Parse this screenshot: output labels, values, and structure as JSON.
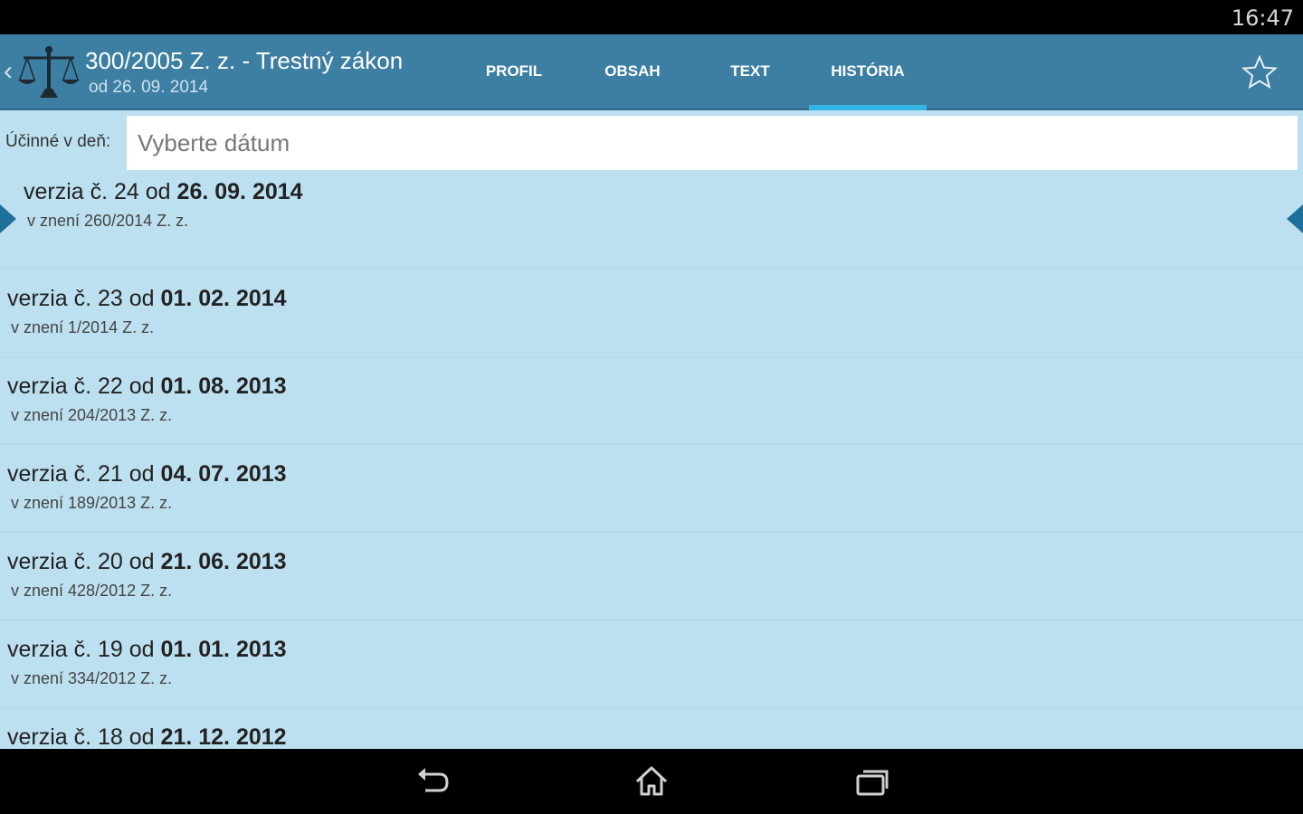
{
  "status_bar": {
    "time": "16:47"
  },
  "header": {
    "title": "300/2005 Z. z. - Trestný zákon",
    "subtitle": "od 26. 09. 2014",
    "logo_icon": "scales-of-justice-icon",
    "back_icon": "chevron-left-icon",
    "favorite_icon": "star-outline-icon"
  },
  "tabs": [
    {
      "label": "PROFIL",
      "active": false
    },
    {
      "label": "OBSAH",
      "active": false
    },
    {
      "label": "TEXT",
      "active": false
    },
    {
      "label": "HISTÓRIA",
      "active": true
    }
  ],
  "filter": {
    "label": "Účinné v deň:",
    "placeholder": "Vyberte dátum"
  },
  "versions": [
    {
      "prefix": "verzia č. 24 od",
      "date": "26. 09. 2014",
      "amendment": "v znení 260/2014 Z. z.",
      "selected": true
    },
    {
      "prefix": "verzia č. 23 od",
      "date": "01. 02. 2014",
      "amendment": "v znení 1/2014 Z. z.",
      "selected": false
    },
    {
      "prefix": "verzia č. 22 od",
      "date": "01. 08. 2013",
      "amendment": "v znení 204/2013 Z. z.",
      "selected": false
    },
    {
      "prefix": "verzia č. 21 od",
      "date": "04. 07. 2013",
      "amendment": "v znení 189/2013 Z. z.",
      "selected": false
    },
    {
      "prefix": "verzia č. 20 od",
      "date": "21. 06. 2013",
      "amendment": "v znení 428/2012 Z. z.",
      "selected": false
    },
    {
      "prefix": "verzia č. 19 od",
      "date": "01. 01. 2013",
      "amendment": "v znení 334/2012 Z. z.",
      "selected": false
    },
    {
      "prefix": "verzia č. 18 od",
      "date": "21. 12. 2012",
      "amendment": "",
      "selected": false
    }
  ],
  "nav_bar": {
    "back_icon": "back-arrow-icon",
    "home_icon": "home-icon",
    "recents_icon": "recent-apps-icon"
  },
  "colors": {
    "action_bar": "#3d7ea3",
    "list_background": "#bde0f0",
    "tab_indicator": "#33b5e5",
    "selection_arrow": "#1e6f99"
  }
}
